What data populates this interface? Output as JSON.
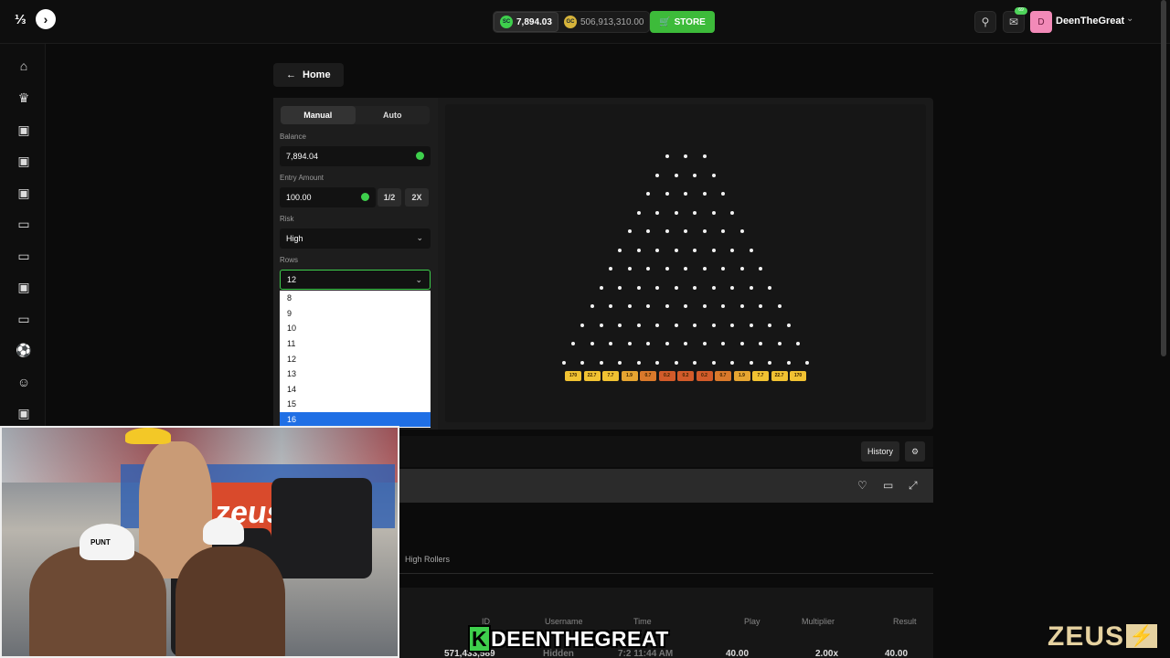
{
  "topbar": {
    "sc_balance": "7,894.03",
    "sc_coin": "SC",
    "gc_balance": "506,913,310.00",
    "gc_coin": "GC",
    "store_label": "STORE",
    "notif_count": "69",
    "avatar_initial": "D",
    "username": "DeenTheGreat"
  },
  "sidebar": {
    "icons": [
      "home-icon",
      "crown-icon",
      "gift-icon",
      "gift-icon",
      "gift-icon",
      "ticket-icon",
      "ticket-icon",
      "gift-icon",
      "ticket-icon",
      "soccer-ball-icon",
      "user-icon",
      "gift-icon"
    ]
  },
  "nav": {
    "home_label": "Home"
  },
  "controls": {
    "tabs": [
      "Manual",
      "Auto"
    ],
    "active_tab": "Manual",
    "balance_label": "Balance",
    "balance_value": "7,894.04",
    "entry_label": "Entry Amount",
    "entry_value": "100.00",
    "half_label": "1/2",
    "double_label": "2X",
    "risk_label": "Risk",
    "risk_value": "High",
    "rows_label": "Rows",
    "rows_value": "12",
    "rows_options": [
      "8",
      "9",
      "10",
      "11",
      "12",
      "13",
      "14",
      "15",
      "16"
    ],
    "rows_highlighted": "16"
  },
  "board": {
    "rows": 12,
    "multipliers": [
      "170",
      "22.7",
      "7.7",
      "1.9",
      "0.7",
      "0.2",
      "0.2",
      "0.2",
      "0.7",
      "1.9",
      "7.7",
      "22.7",
      "170"
    ],
    "colors": {
      "high": "#f1c232",
      "mid": "#e6a531",
      "low": "#d9792b",
      "lowest": "#d25b2a"
    }
  },
  "activity": {
    "history_label": "History",
    "tab_high_rollers": "High Rollers",
    "columns": [
      "ID",
      "Username",
      "Time",
      "Play",
      "Multiplier",
      "Result"
    ],
    "row": {
      "id": "571,433,589",
      "username": "Hidden",
      "time": "7:2 11:44 AM",
      "play": "40.00",
      "multiplier": "2.00x",
      "result": "40.00"
    }
  },
  "stream": {
    "caption_k": "K",
    "caption_text": "DEENTHEGREAT",
    "brand": "ZEUS",
    "banner_text": "zeus",
    "hat_text": "PUNT"
  }
}
